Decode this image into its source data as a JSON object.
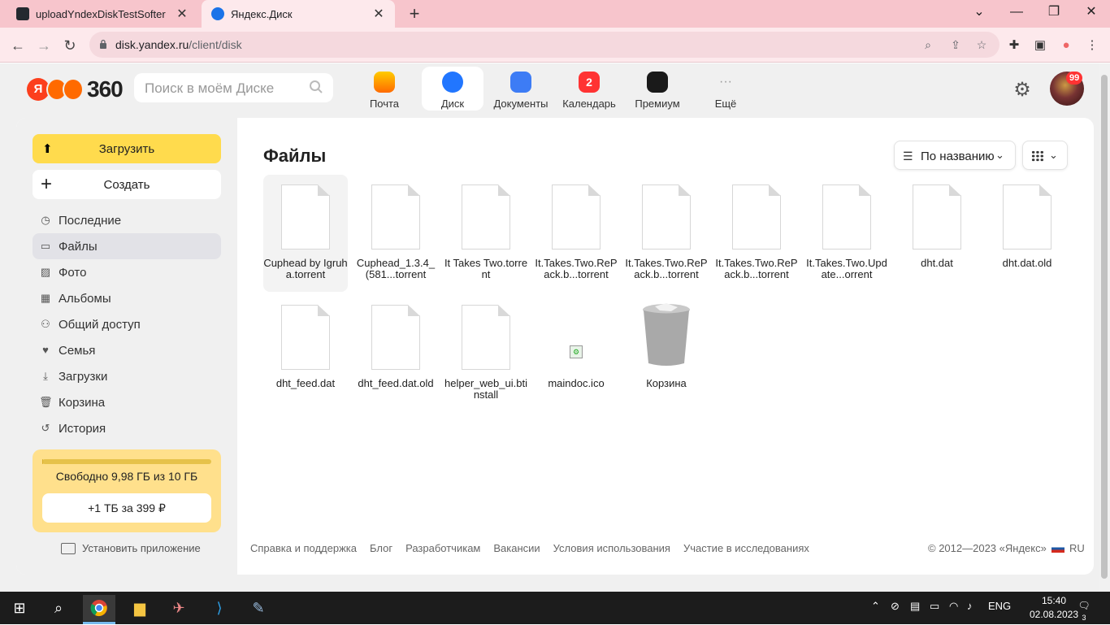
{
  "browser": {
    "tabs": [
      {
        "title": "uploadYndexDiskTestSofter",
        "close": "✕"
      },
      {
        "title": "Яндекс.Диск",
        "close": "✕"
      }
    ],
    "new_tab": "+",
    "url_host": "disk.yandex.ru",
    "url_path": "/client/disk"
  },
  "header": {
    "logo_letter": "Я",
    "logo_text": "360",
    "search_placeholder": "Поиск в моём Диске",
    "services": [
      {
        "label": "Почта",
        "color": "#ff9900"
      },
      {
        "label": "Диск",
        "color": "#2176ff"
      },
      {
        "label": "Документы",
        "color": "#3d7cf5"
      },
      {
        "label": "Календарь",
        "badge": "2"
      },
      {
        "label": "Премиум",
        "color": "#1a1a1a"
      },
      {
        "label": "Ещё"
      }
    ],
    "avatar_badge": "99"
  },
  "sidebar": {
    "upload_label": "Загрузить",
    "create_label": "Создать",
    "items": [
      {
        "label": "Последние",
        "icon": "clock-icon"
      },
      {
        "label": "Файлы",
        "icon": "folder-icon"
      },
      {
        "label": "Фото",
        "icon": "photo-icon"
      },
      {
        "label": "Альбомы",
        "icon": "album-icon"
      },
      {
        "label": "Общий доступ",
        "icon": "share-icon"
      },
      {
        "label": "Семья",
        "icon": "family-icon"
      },
      {
        "label": "Загрузки",
        "icon": "download-icon"
      },
      {
        "label": "Корзина",
        "icon": "trash-icon"
      },
      {
        "label": "История",
        "icon": "history-icon"
      }
    ],
    "active_index": 1,
    "storage_text": "Свободно 9,98 ГБ из 10 ГБ",
    "storage_used_fraction": 0.998,
    "storage_buy": "+1 ТБ за 399 ₽",
    "install_app": "Установить приложение"
  },
  "main": {
    "title": "Файлы",
    "sort_label": "По названию",
    "files": [
      {
        "name": "Cuphead by Igruha.torrent",
        "type": "doc",
        "selected": true
      },
      {
        "name": "Cuphead_1.3.4_(581...torrent",
        "type": "doc"
      },
      {
        "name": "It Takes Two.torrent",
        "type": "doc"
      },
      {
        "name": "It.Takes.Two.RePack.b...torrent",
        "type": "doc"
      },
      {
        "name": "It.Takes.Two.RePack.b...torrent",
        "type": "doc"
      },
      {
        "name": "It.Takes.Two.RePack.b...torrent",
        "type": "doc"
      },
      {
        "name": "It.Takes.Two.Update...orrent",
        "type": "doc"
      },
      {
        "name": "dht.dat",
        "type": "doc"
      },
      {
        "name": "dht.dat.old",
        "type": "doc"
      },
      {
        "name": "dht_feed.dat",
        "type": "doc"
      },
      {
        "name": "dht_feed.dat.old",
        "type": "doc"
      },
      {
        "name": "helper_web_ui.btinstall",
        "type": "doc"
      },
      {
        "name": "maindoc.ico",
        "type": "ico"
      },
      {
        "name": "Корзина",
        "type": "trash"
      }
    ]
  },
  "footer": {
    "links": [
      "Справка и поддержка",
      "Блог",
      "Разработчикам",
      "Вакансии",
      "Условия использования",
      "Участие в исследованиях"
    ],
    "copyright": "© 2012—2023 «Яндекс»",
    "lang": "RU"
  },
  "taskbar": {
    "lang": "ENG",
    "time": "15:40",
    "date": "02.08.2023",
    "notifications": "3"
  }
}
